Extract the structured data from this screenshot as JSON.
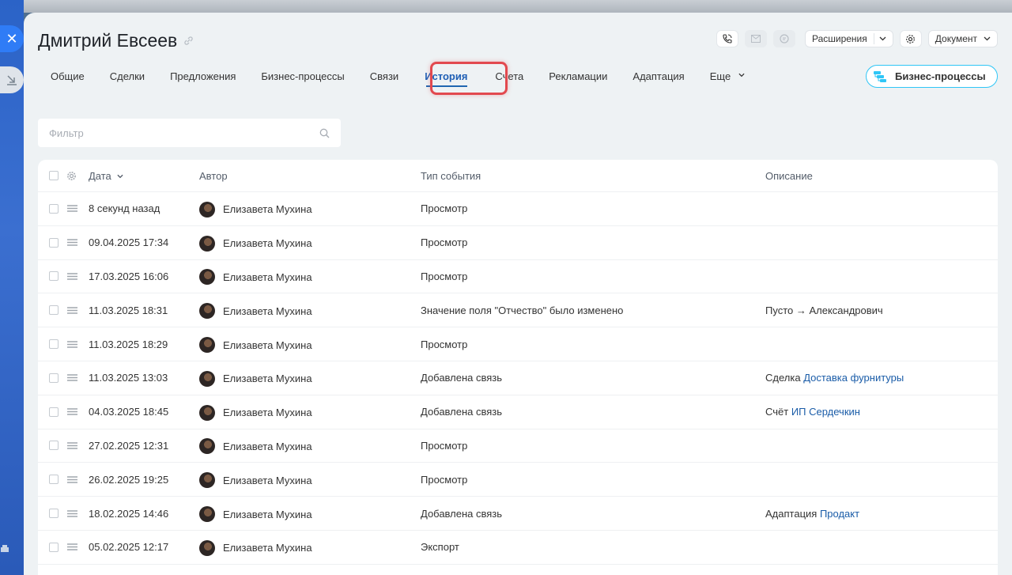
{
  "window": {
    "title": "Дмитрий Евсеев"
  },
  "top_actions": {
    "extensions_label": "Расширения",
    "document_label": "Документ"
  },
  "tabs": [
    {
      "label": "Общие"
    },
    {
      "label": "Сделки"
    },
    {
      "label": "Предложения"
    },
    {
      "label": "Бизнес-процессы"
    },
    {
      "label": "Связи"
    },
    {
      "label": "История",
      "active": true
    },
    {
      "label": "Счета"
    },
    {
      "label": "Рекламации"
    },
    {
      "label": "Адаптация"
    },
    {
      "label": "Еще"
    }
  ],
  "bp_button": {
    "label": "Бизнес-процессы"
  },
  "filter": {
    "placeholder": "Фильтр"
  },
  "grid": {
    "headers": {
      "date": "Дата",
      "author": "Автор",
      "type": "Тип события",
      "desc": "Описание"
    },
    "rows": [
      {
        "date": "8 секунд назад",
        "author": "Елизавета Мухина",
        "type": "Просмотр",
        "desc_text": "",
        "desc_link": ""
      },
      {
        "date": "09.04.2025 17:34",
        "author": "Елизавета Мухина",
        "type": "Просмотр",
        "desc_text": "",
        "desc_link": ""
      },
      {
        "date": "17.03.2025 16:06",
        "author": "Елизавета Мухина",
        "type": "Просмотр",
        "desc_text": "",
        "desc_link": ""
      },
      {
        "date": "11.03.2025 18:31",
        "author": "Елизавета Мухина",
        "type": "Значение поля \"Отчество\" было изменено",
        "desc_text": "Пусто → Александрович",
        "desc_link": ""
      },
      {
        "date": "11.03.2025 18:29",
        "author": "Елизавета Мухина",
        "type": "Просмотр",
        "desc_text": "",
        "desc_link": ""
      },
      {
        "date": "11.03.2025 13:03",
        "author": "Елизавета Мухина",
        "type": "Добавлена связь",
        "desc_text": "Сделка ",
        "desc_link": "Доставка фурнитуры"
      },
      {
        "date": "04.03.2025 18:45",
        "author": "Елизавета Мухина",
        "type": "Добавлена связь",
        "desc_text": "Счёт ",
        "desc_link": "ИП Сердечкин"
      },
      {
        "date": "27.02.2025 12:31",
        "author": "Елизавета Мухина",
        "type": "Просмотр",
        "desc_text": "",
        "desc_link": ""
      },
      {
        "date": "26.02.2025 19:25",
        "author": "Елизавета Мухина",
        "type": "Просмотр",
        "desc_text": "",
        "desc_link": ""
      },
      {
        "date": "18.02.2025 14:46",
        "author": "Елизавета Мухина",
        "type": "Добавлена связь",
        "desc_text": "Адаптация ",
        "desc_link": "Продакт"
      },
      {
        "date": "05.02.2025 12:17",
        "author": "Елизавета Мухина",
        "type": "Экспорт",
        "desc_text": "",
        "desc_link": ""
      }
    ]
  },
  "colors": {
    "accent": "#2066b0",
    "highlight": "#e2494f",
    "link": "#1a5ca8"
  }
}
